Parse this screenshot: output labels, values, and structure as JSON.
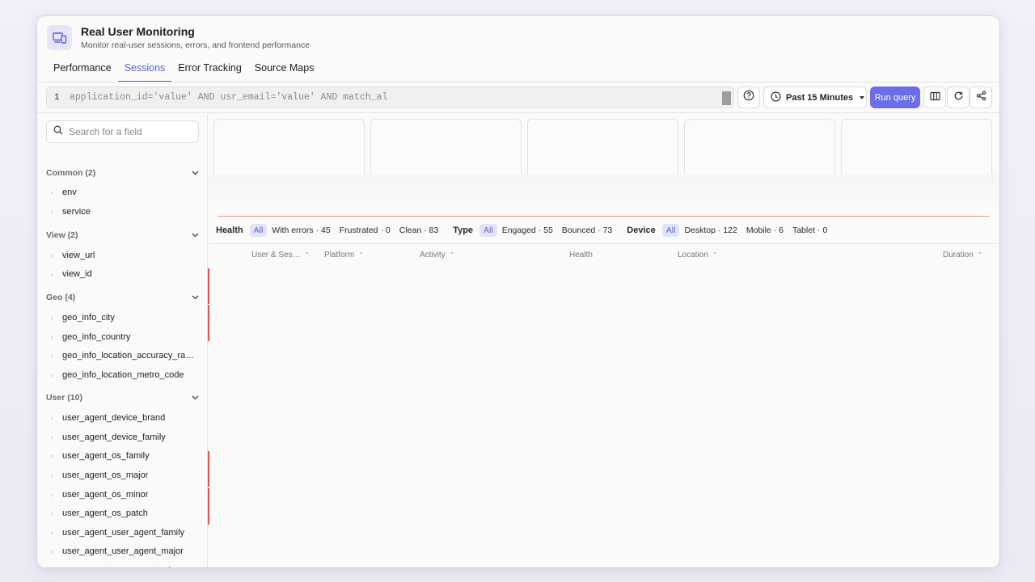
{
  "app": {
    "title": "Real User Monitoring",
    "subtitle": "Monitor real-user sessions, errors, and frontend performance",
    "icon": "devices-icon"
  },
  "tabs": [
    {
      "label": "Performance",
      "active": false
    },
    {
      "label": "Sessions",
      "active": true
    },
    {
      "label": "Error Tracking",
      "active": false
    },
    {
      "label": "Source Maps",
      "active": false
    }
  ],
  "query": {
    "line_number": "1",
    "text": "application_id='value' AND usr_email='value' AND match_al",
    "time_range": "Past 15 Minutes",
    "run_label": "Run query"
  },
  "sidebar": {
    "search_placeholder": "Search for a field",
    "groups": [
      {
        "label": "Common (2)",
        "fields": [
          "env",
          "service"
        ]
      },
      {
        "label": "View (2)",
        "fields": [
          "view_url",
          "view_id"
        ]
      },
      {
        "label": "Geo (4)",
        "fields": [
          "geo_info_city",
          "geo_info_country",
          "geo_info_location_accuracy_ra…",
          "geo_info_location_metro_code"
        ]
      },
      {
        "label": "User (10)",
        "fields": [
          "user_agent_device_brand",
          "user_agent_device_family",
          "user_agent_os_family",
          "user_agent_os_major",
          "user_agent_os_minor",
          "user_agent_os_patch",
          "user_agent_user_agent_family",
          "user_agent_user_agent_major",
          "user_agent_user_agent_minor"
        ]
      }
    ]
  },
  "filters": {
    "health": {
      "label": "Health",
      "all": "All",
      "with_errors": "With errors",
      "with_errors_count": "45",
      "frustrated": "Frustrated",
      "frustrated_count": "0",
      "clean": "Clean",
      "clean_count": "83"
    },
    "type": {
      "label": "Type",
      "all": "All",
      "engaged": "Engaged",
      "engaged_count": "55",
      "bounced": "Bounced",
      "bounced_count": "73"
    },
    "device": {
      "label": "Device",
      "all": "All",
      "desktop": "Desktop",
      "desktop_count": "122",
      "mobile": "Mobile",
      "mobile_count": "6",
      "tablet": "Tablet",
      "tablet_count": "0"
    }
  },
  "table": {
    "columns": [
      "User & Ses…",
      "Platform",
      "Activity",
      "Health",
      "Location",
      "Duration"
    ]
  },
  "colors": {
    "accent": "#5a5fe0",
    "run_button": "#6b6ee6",
    "error": "#e0544b"
  }
}
